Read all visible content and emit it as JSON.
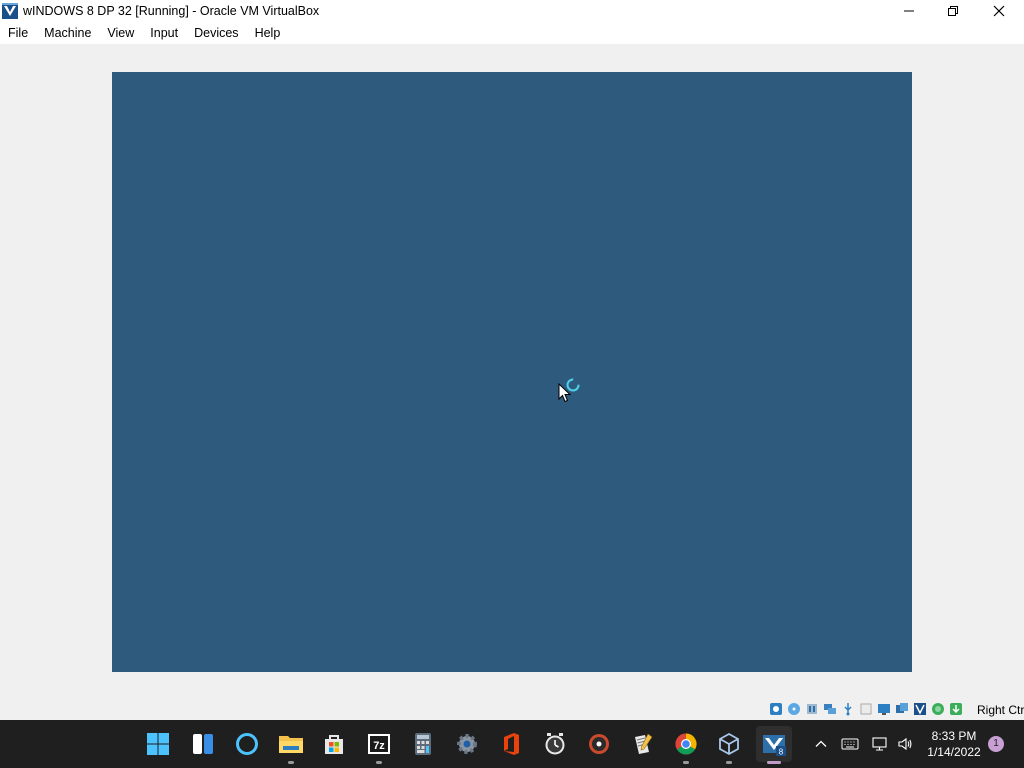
{
  "window": {
    "title": "wINDOWS 8 DP 32 [Running] - Oracle VM VirtualBox",
    "app_icon": "virtualbox-icon",
    "controls": [
      "minimize-icon",
      "restore-icon",
      "close-icon"
    ]
  },
  "menu": {
    "items": [
      "File",
      "Machine",
      "View",
      "Input",
      "Devices",
      "Help"
    ]
  },
  "vm_screen": {
    "background": "#2e5a7e",
    "state": "loading",
    "spinner_icon": "loading-spinner-icon",
    "cursor_icon": "mouse-pointer-icon"
  },
  "statusbar": {
    "icons": [
      "hard-disk-icon",
      "optical-drive-icon",
      "audio-icon",
      "network-icon",
      "usb-icon",
      "shared-folders-icon",
      "display-icon",
      "video-capture-icon",
      "virtualization-icon",
      "mouse-integration-icon",
      "keyboard-capture-icon",
      "host-key-arrow-icon"
    ],
    "host_key": "Right Ctrl"
  },
  "taskbar": {
    "pinned": [
      {
        "name": "start-icon",
        "running": false
      },
      {
        "name": "widgets-icon",
        "running": false
      },
      {
        "name": "cortana-icon",
        "running": false
      },
      {
        "name": "file-explorer-icon",
        "running": true
      },
      {
        "name": "microsoft-store-icon",
        "running": false
      },
      {
        "name": "7zip-icon",
        "running": true
      },
      {
        "name": "calculator-icon",
        "running": false
      },
      {
        "name": "settings-icon",
        "running": false
      },
      {
        "name": "office-icon",
        "running": false
      },
      {
        "name": "clock-app-icon",
        "running": false
      },
      {
        "name": "media-player-icon",
        "running": false
      },
      {
        "name": "notepad-icon",
        "running": false
      },
      {
        "name": "chrome-icon",
        "running": true
      },
      {
        "name": "virtualbox-manager-icon",
        "running": true
      },
      {
        "name": "virtualbox-vm-icon",
        "running": true,
        "active": true
      }
    ],
    "tray": {
      "overflow_icon": "chevron-up-icon",
      "keyboard_icon": "touch-keyboard-icon",
      "network_icon": "network-wired-icon",
      "volume_icon": "speaker-icon",
      "time": "8:33 PM",
      "date": "1/14/2022",
      "notification_count": "1"
    }
  },
  "colors": {
    "vm_background": "#2e5a7e",
    "taskbar": "#1f1f1f",
    "window_chrome": "#f0f0f0",
    "accent": "#c8a0d4"
  }
}
